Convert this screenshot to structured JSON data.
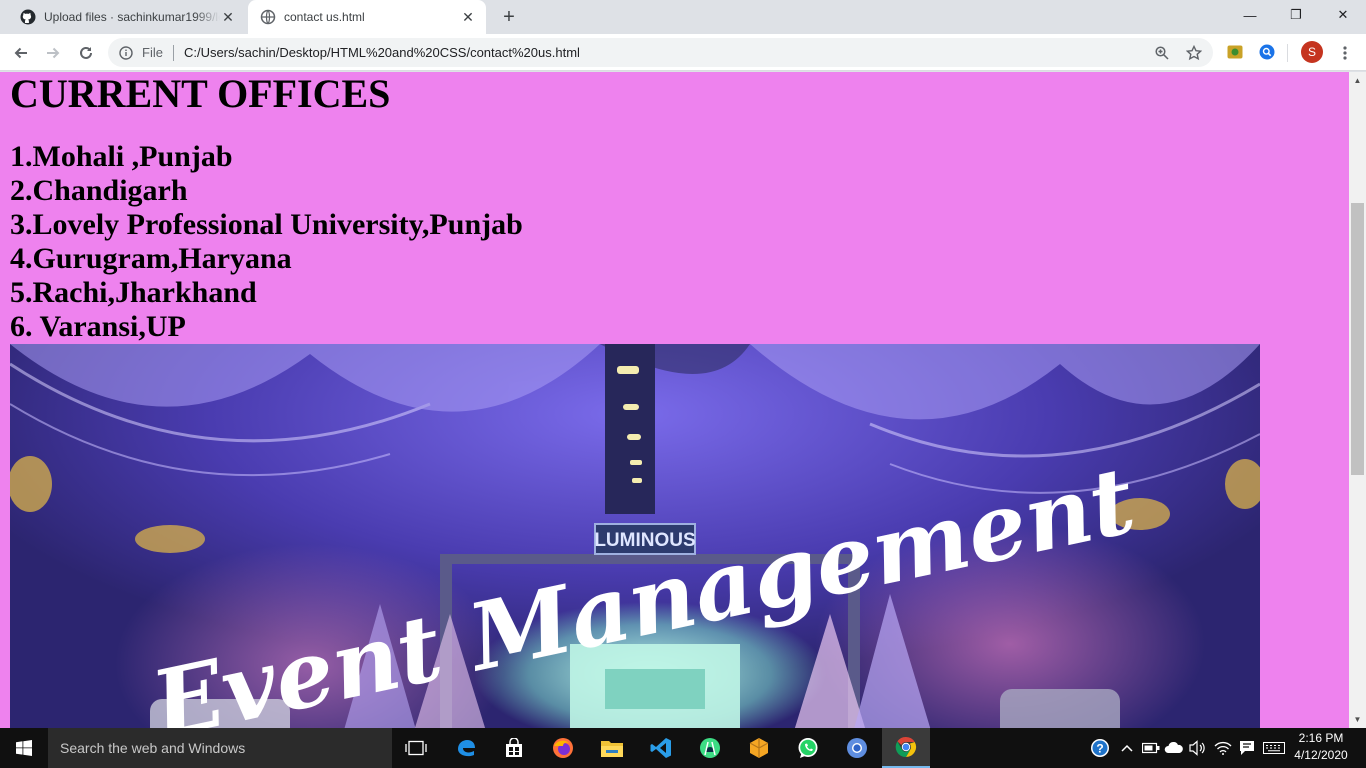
{
  "browser": {
    "tabs": [
      {
        "title": "Upload files · sachinkumar1999/le",
        "favicon": "github-icon",
        "active": false
      },
      {
        "title": "contact us.html",
        "favicon": "globe-icon",
        "active": true
      }
    ],
    "new_tab_label": "+",
    "window_controls": {
      "minimize": "—",
      "maximize": "❐",
      "close": "✕"
    },
    "address_bar": {
      "scheme_label": "File",
      "url": "C:/Users/sachin/Desktop/HTML%20and%20CSS/contact%20us.html"
    },
    "profile_initial": "S",
    "profile_color": "#c5341f"
  },
  "page": {
    "background_color": "#ee82ee",
    "heading": "CURRENT OFFICES",
    "offices": [
      "1.Mohali ,Punjab",
      "2.Chandigarh",
      "3.Lovely Professional University,Punjab",
      "4.Gurugram,Haryana",
      "5.Rachi,Jharkhand",
      "6. Varansi,UP"
    ],
    "banner": {
      "script_text": "Event Management",
      "stage_sign": "LUMINOUS"
    }
  },
  "taskbar": {
    "search_placeholder": "Search the web and Windows",
    "pinned_apps": [
      "task-view-icon",
      "edge-icon",
      "store-icon",
      "firefox-icon",
      "file-explorer-icon",
      "vscode-icon",
      "android-studio-icon",
      "package-icon",
      "whatsapp-icon",
      "chromium-icon",
      "chrome-icon"
    ],
    "active_app": "chrome-icon",
    "clock": {
      "time": "2:16 PM",
      "date": "4/12/2020"
    }
  }
}
